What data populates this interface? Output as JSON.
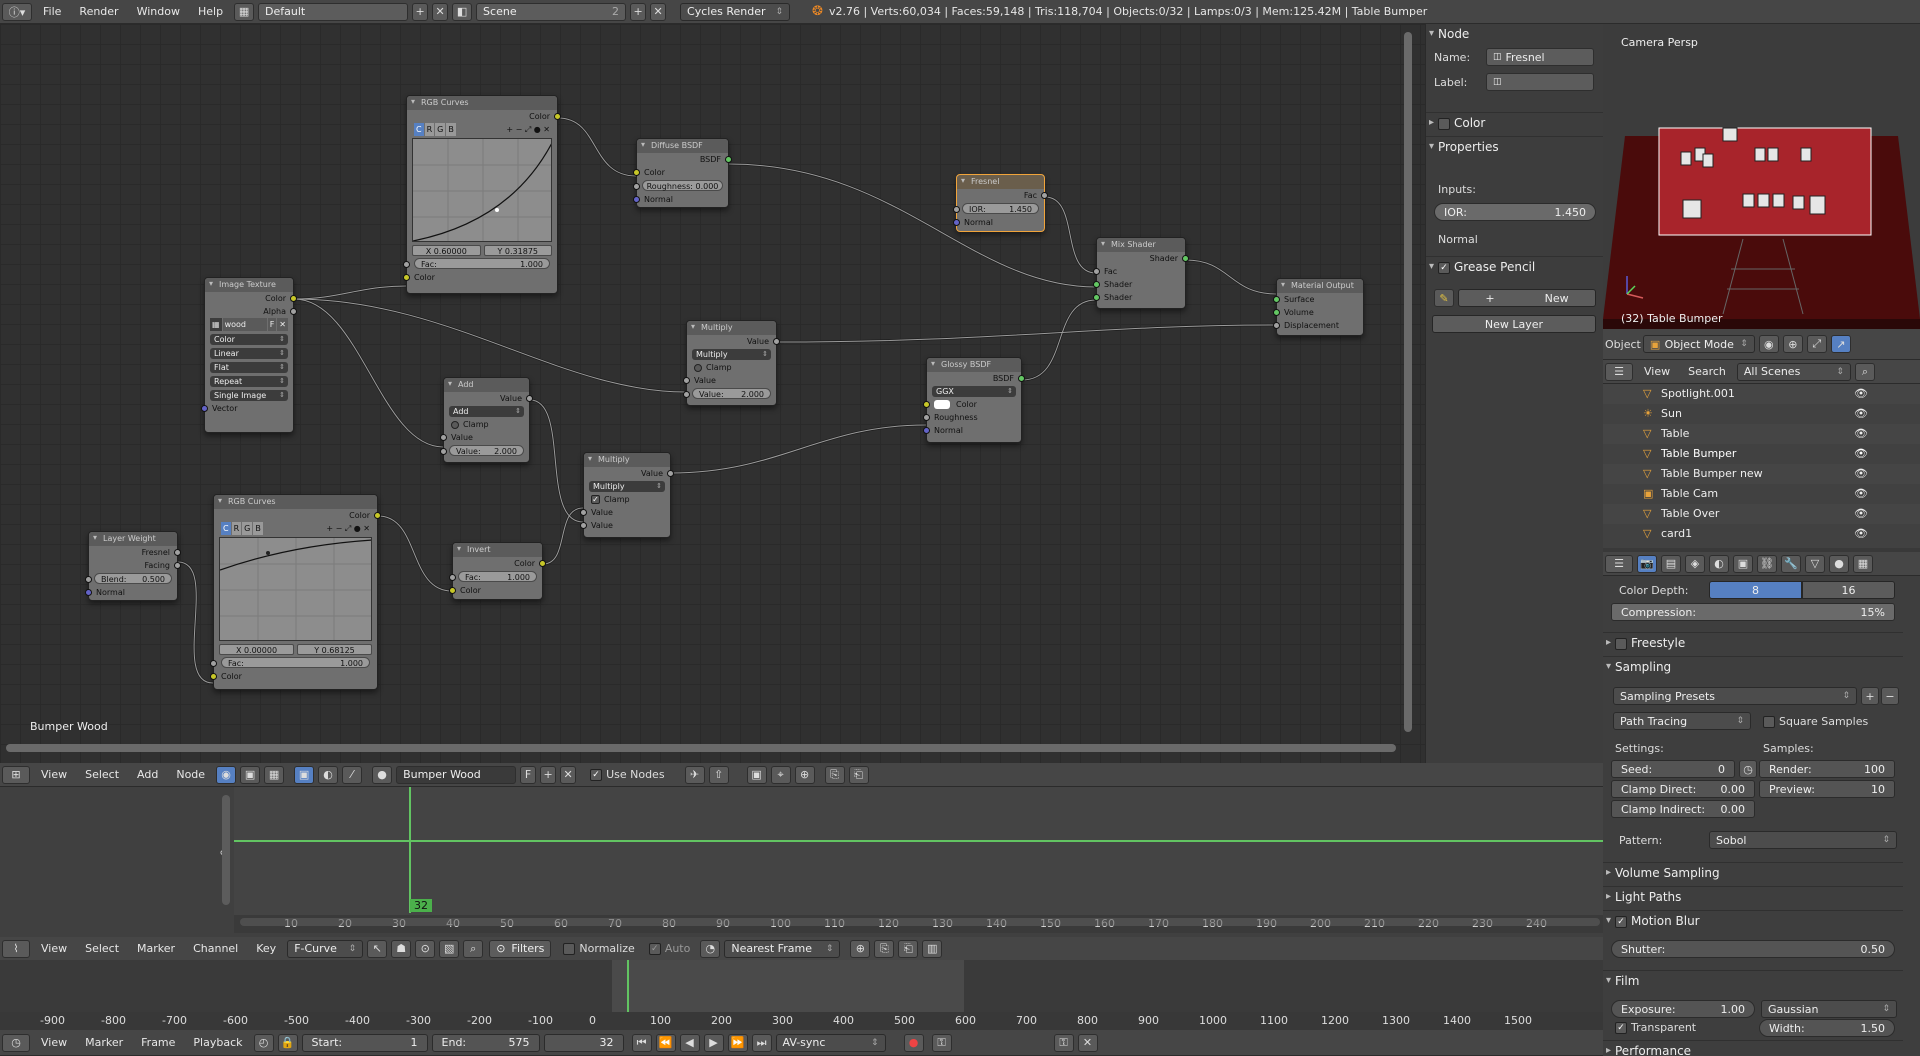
{
  "topbar": {
    "menus": [
      "File",
      "Render",
      "Window",
      "Help"
    ],
    "layout": "Default",
    "scene": "Scene",
    "scene_users": "2",
    "engine": "Cycles Render",
    "stats": "v2.76 | Verts:60,034 | Faces:59,148 | Tris:118,704 | Objects:0/32 | Lamps:0/3 | Mem:125.42M | Table Bumper"
  },
  "nodes": {
    "rgb1": {
      "title": "RGB Curves",
      "out": "Color",
      "channels": [
        "C",
        "R",
        "G",
        "B"
      ],
      "x": "X 0.60000",
      "y": "Y 0.31875",
      "fac_label": "Fac:",
      "fac": "1.000",
      "in": "Color"
    },
    "diffuse": {
      "title": "Diffuse BSDF",
      "out": "BSDF",
      "color": "Color",
      "rough": "Roughness: 0.000",
      "normal": "Normal"
    },
    "fresnel": {
      "title": "Fresnel",
      "out": "Fac",
      "ior": "IOR:",
      "ior_v": "1.450",
      "normal": "Normal"
    },
    "mix": {
      "title": "Mix Shader",
      "out": "Shader",
      "fac": "Fac",
      "s1": "Shader",
      "s2": "Shader"
    },
    "matout": {
      "title": "Material Output",
      "surface": "Surface",
      "volume": "Volume",
      "disp": "Displacement"
    },
    "imgtex": {
      "title": "Image Texture",
      "color": "Color",
      "alpha": "Alpha",
      "img": "wood",
      "f": "F",
      "opts": [
        "Color",
        "Linear",
        "Flat",
        "Repeat",
        "Single Image"
      ],
      "vector": "Vector"
    },
    "mult1": {
      "title": "Multiply",
      "out": "Value",
      "op": "Multiply",
      "clamp": "Clamp",
      "value": "Value",
      "v2": "Value:",
      "v2v": "2.000"
    },
    "glossy": {
      "title": "Glossy BSDF",
      "out": "BSDF",
      "dist": "GGX",
      "color": "Color",
      "rough": "Roughness",
      "normal": "Normal"
    },
    "add": {
      "title": "Add",
      "out": "Value",
      "op": "Add",
      "clamp": "Clamp",
      "value": "Value",
      "v2": "Value:",
      "v2v": "2.000"
    },
    "mult2": {
      "title": "Multiply",
      "out": "Value",
      "op": "Multiply",
      "clamp": "Clamp",
      "v1": "Value",
      "v2": "Value"
    },
    "layerw": {
      "title": "Layer Weight",
      "fresnel": "Fresnel",
      "facing": "Facing",
      "blend": "Blend:",
      "blend_v": "0.500",
      "normal": "Normal"
    },
    "rgb2": {
      "title": "RGB Curves",
      "out": "Color",
      "channels": [
        "C",
        "R",
        "G",
        "B"
      ],
      "x": "X 0.00000",
      "y": "Y 0.68125",
      "fac_label": "Fac:",
      "fac": "1.000",
      "in": "Color"
    },
    "invert": {
      "title": "Invert",
      "out": "Color",
      "fac_label": "Fac:",
      "fac": "1.000",
      "in": "Color"
    }
  },
  "editor": {
    "material_label": "Bumper Wood"
  },
  "nodebar": {
    "menus": [
      "View",
      "Select",
      "Add",
      "Node"
    ],
    "material": "Bumper Wood",
    "f": "F",
    "use_nodes": "Use Nodes"
  },
  "nodepanel": {
    "node_title": "Node",
    "name_label": "Name:",
    "name": "Fresnel",
    "label_label": "Label:",
    "color": "Color",
    "properties": "Properties",
    "inputs": "Inputs:",
    "ior_label": "IOR:",
    "ior": "1.450",
    "normal": "Normal",
    "grease": "Grease Pencil",
    "new": "New",
    "new_layer": "New Layer"
  },
  "view3d": {
    "title": "Camera Persp",
    "object": "(32) Table Bumper",
    "mode": "Object Mode",
    "obj_label": "Object"
  },
  "outliner": {
    "menus": [
      "View",
      "Search"
    ],
    "filter": "All Scenes",
    "items": [
      "Spotlight.001",
      "Sun",
      "Table",
      "Table Bumper",
      "Table Bumper new",
      "Table Cam",
      "Table Over",
      "card1"
    ]
  },
  "props": {
    "color_depth": "Color Depth:",
    "depth_8": "8",
    "depth_16": "16",
    "compression": "Compression:",
    "compression_v": "15%",
    "freestyle": "Freestyle",
    "sampling": "Sampling",
    "presets": "Sampling Presets",
    "integrator": "Path Tracing",
    "square": "Square Samples",
    "settings": "Settings:",
    "samples": "Samples:",
    "seed": "Seed:",
    "seed_v": "0",
    "render": "Render:",
    "render_v": "100",
    "clamp_direct": "Clamp Direct:",
    "clamp_direct_v": "0.00",
    "preview": "Preview:",
    "preview_v": "10",
    "clamp_indirect": "Clamp Indirect:",
    "clamp_indirect_v": "0.00",
    "pattern": "Pattern:",
    "pattern_v": "Sobol",
    "volume": "Volume Sampling",
    "light": "Light Paths",
    "motion": "Motion Blur",
    "shutter": "Shutter:",
    "shutter_v": "0.50",
    "film": "Film",
    "exposure": "Exposure:",
    "exposure_v": "1.00",
    "filter": "Gaussian",
    "transparent": "Transparent",
    "width": "Width:",
    "width_v": "1.50",
    "performance": "Performance"
  },
  "timeline": {
    "frame": "32",
    "ticks": [
      "10",
      "20",
      "30",
      "40",
      "50",
      "60",
      "70",
      "80",
      "90",
      "100",
      "110",
      "120",
      "130",
      "140",
      "150",
      "160",
      "170",
      "180",
      "190",
      "200",
      "210",
      "220",
      "230",
      "240"
    ],
    "zero": "0"
  },
  "graphbar": {
    "menus": [
      "View",
      "Select",
      "Marker",
      "Channel",
      "Key"
    ],
    "mode": "F-Curve",
    "filters": "Filters",
    "normalize": "Normalize",
    "auto": "Auto",
    "snap": "Nearest Frame"
  },
  "graph": {
    "ticks": [
      "-900",
      "-800",
      "-700",
      "-600",
      "-500",
      "-400",
      "-300",
      "-200",
      "-100",
      "0",
      "100",
      "200",
      "300",
      "400",
      "500",
      "600",
      "700",
      "800",
      "900",
      "1000",
      "1100",
      "1200",
      "1300",
      "1400",
      "1500"
    ]
  },
  "bottombar": {
    "menus": [
      "View",
      "Marker",
      "Frame",
      "Playback"
    ],
    "start_label": "Start:",
    "start": "1",
    "end_label": "End:",
    "end": "575",
    "current": "32",
    "sync": "AV-sync"
  }
}
